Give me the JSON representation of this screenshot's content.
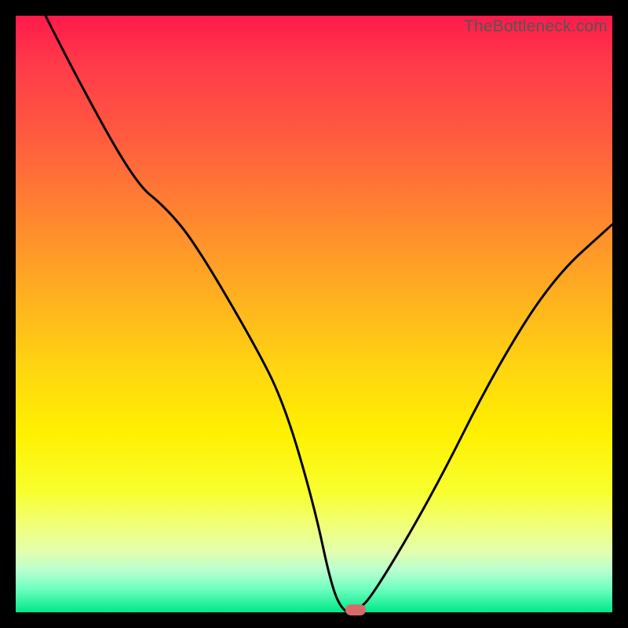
{
  "watermark": "TheBottleneck.com",
  "colors": {
    "frame_bg": "#000000",
    "curve": "#000000",
    "marker": "#d86a6a"
  },
  "chart_data": {
    "type": "line",
    "title": "",
    "xlabel": "",
    "ylabel": "",
    "xlim": [
      0,
      100
    ],
    "ylim": [
      0,
      100
    ],
    "grid": false,
    "series": [
      {
        "name": "bottleneck-curve",
        "x": [
          5,
          10,
          20,
          25,
          30,
          40,
          45,
          50,
          53,
          55,
          57,
          60,
          70,
          80,
          90,
          100
        ],
        "y": [
          100,
          90,
          72,
          68,
          62,
          45,
          35,
          18,
          4,
          0,
          0,
          3,
          20,
          40,
          56,
          65
        ]
      }
    ],
    "annotations": [
      {
        "name": "optimal-marker",
        "x": 57,
        "y": 0,
        "shape": "pill"
      }
    ],
    "note": "x/y are percentages of the plot area; y=0 is the green bottom edge, y=100 is the top red edge"
  }
}
